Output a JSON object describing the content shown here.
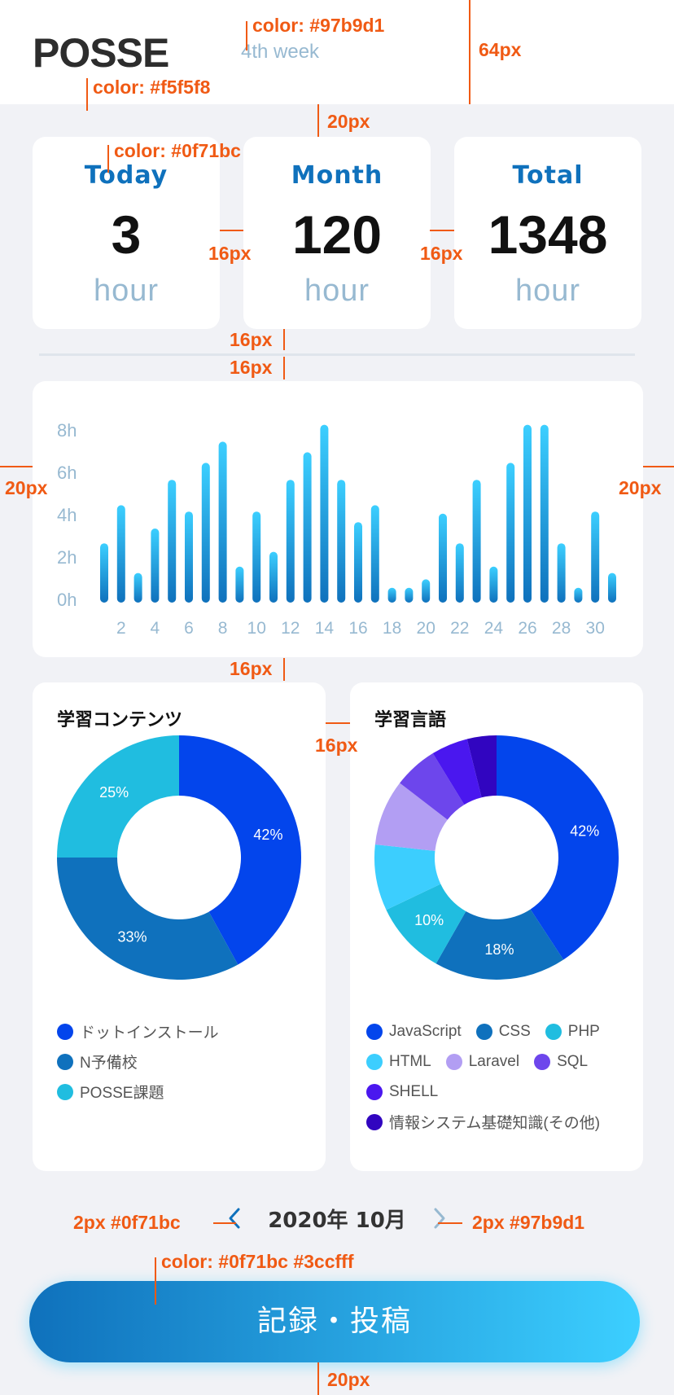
{
  "header": {
    "logo_text": "POSSE",
    "week": "4th week"
  },
  "stats": [
    {
      "label": "Today",
      "value": "3",
      "unit": "hour"
    },
    {
      "label": "Month",
      "value": "120",
      "unit": "hour"
    },
    {
      "label": "Total",
      "value": "1348",
      "unit": "hour"
    }
  ],
  "annotations": {
    "color_week": "color: #97b9d1",
    "h64": "64px",
    "color_header": "color: #f5f5f8",
    "gap20a": "20px",
    "color_label": "color: #0f71bc",
    "gap16a": "16px",
    "gap16b": "16px",
    "gap16c": "16px",
    "gap16d": "16px",
    "side20l": "20px",
    "side20r": "20px",
    "gap16e": "16px",
    "gap16f": "16px",
    "arrow_left": "2px  #0f71bc",
    "arrow_right": "2px  #97b9d1",
    "btn_color": "color: #0f71bc   #3ccfff",
    "gap20b": "20px"
  },
  "chart_data": [
    {
      "type": "bar",
      "x": [
        1,
        2,
        3,
        4,
        5,
        6,
        7,
        8,
        9,
        10,
        11,
        12,
        13,
        14,
        15,
        16,
        17,
        18,
        19,
        20,
        21,
        22,
        23,
        24,
        25,
        26,
        27,
        28,
        29,
        30,
        31
      ],
      "values": [
        2.8,
        4.6,
        1.4,
        3.5,
        5.8,
        4.3,
        6.6,
        7.6,
        1.7,
        4.3,
        2.4,
        5.8,
        7.1,
        8.4,
        5.8,
        3.8,
        4.6,
        0.7,
        0.7,
        1.1,
        4.2,
        2.8,
        5.8,
        1.7,
        6.6,
        8.4,
        8.4,
        2.8,
        0.7,
        4.3,
        1.4
      ],
      "xticks": [
        "2",
        "4",
        "6",
        "8",
        "10",
        "12",
        "14",
        "16",
        "18",
        "20",
        "22",
        "24",
        "26",
        "28",
        "30"
      ],
      "yticks": [
        "0h",
        "2h",
        "4h",
        "6h",
        "8h"
      ],
      "ylim": [
        0,
        8
      ],
      "colors": {
        "top": "#3ccfff",
        "bottom": "#0f71bc"
      }
    },
    {
      "type": "pie",
      "title": "学習コンテンツ",
      "labels": [
        "ドットインストール",
        "N予備校",
        "POSSE課題"
      ],
      "values": [
        42,
        33,
        25
      ],
      "display_labels": [
        "42%",
        "33%",
        "25%"
      ],
      "colors": [
        "#0345ec",
        "#0f71bd",
        "#20bde0"
      ]
    },
    {
      "type": "pie",
      "title": "学習言語",
      "labels": [
        "JavaScript",
        "CSS",
        "PHP",
        "HTML",
        "Laravel",
        "SQL",
        "SHELL",
        "情報システム基礎知識(その他)"
      ],
      "values": [
        42,
        18,
        10,
        9,
        9,
        6,
        5,
        4
      ],
      "display_labels": [
        "42%",
        "18%",
        "10%",
        "",
        "",
        "",
        "",
        ""
      ],
      "colors": [
        "#0345ec",
        "#0f71bd",
        "#20bde0",
        "#3ccefe",
        "#b29ef3",
        "#6d46ec",
        "#4a17ef",
        "#3105c0"
      ]
    }
  ],
  "month_nav": {
    "label": "2020年 10月",
    "prev_color": "#0f71bc",
    "next_color": "#97b9d1"
  },
  "post_button": {
    "label": "記録・投稿"
  }
}
